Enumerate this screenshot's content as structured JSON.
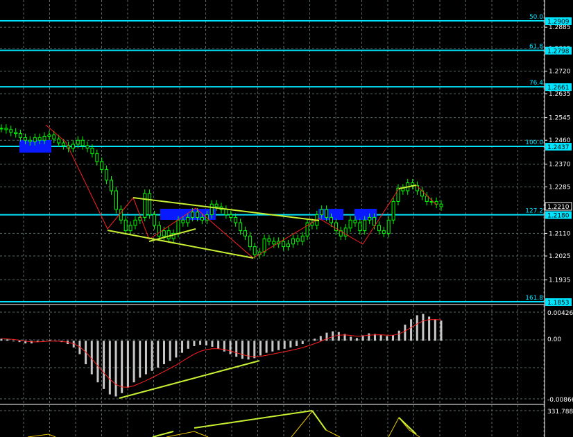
{
  "colors": {
    "background": "#000000",
    "grid": "#5a6a6a",
    "candle": "#00ff00",
    "fib_line": "#00e5ff",
    "zone": "#0a1aff",
    "trendline": "#c8f032",
    "macd_hist": "#c8c8c8",
    "signal": "#ff2020",
    "axis_text": "#ffffff"
  },
  "price_axis": {
    "ticks": [
      "1.2885",
      "1.2805",
      "1.2720",
      "1.2635",
      "1.2545",
      "1.2460",
      "1.2370",
      "1.2285",
      "1.2110",
      "1.2025",
      "1.1935"
    ],
    "current_price": "1.2210"
  },
  "fib_levels": [
    {
      "ratio": "50.0",
      "price": "1.2909"
    },
    {
      "ratio": "61.8",
      "price": "1.2798"
    },
    {
      "ratio": "76.4",
      "price": "1.2661"
    },
    {
      "ratio": "100.0",
      "price": "1.2437"
    },
    {
      "ratio": "127.2",
      "price": "1.2180"
    },
    {
      "ratio": "161.8",
      "price": "1.1853"
    }
  ],
  "macd_axis": {
    "top": "0.00426",
    "zero": "0.00",
    "bottom": "-0.00866"
  },
  "oscillator_axis": {
    "top": "331.7881"
  },
  "chart_data": {
    "type": "candlestick",
    "title": "",
    "series_close": [
      1.2505,
      1.25,
      1.249,
      1.2485,
      1.247,
      1.246,
      1.2455,
      1.247,
      1.246,
      1.2475,
      1.248,
      1.2465,
      1.245,
      1.244,
      1.243,
      1.2445,
      1.246,
      1.244,
      1.243,
      1.241,
      1.238,
      1.235,
      1.231,
      1.227,
      1.22,
      1.216,
      1.212,
      1.214,
      1.216,
      1.217,
      1.226,
      1.218,
      1.214,
      1.21,
      1.212,
      1.209,
      1.211,
      1.216,
      1.215,
      1.217,
      1.219,
      1.217,
      1.216,
      1.218,
      1.222,
      1.221,
      1.22,
      1.218,
      1.217,
      1.215,
      1.212,
      1.21,
      1.206,
      1.203,
      1.204,
      1.209,
      1.208,
      1.207,
      1.208,
      1.206,
      1.207,
      1.209,
      1.208,
      1.21,
      1.215,
      1.214,
      1.218,
      1.22,
      1.217,
      1.215,
      1.212,
      1.21,
      1.213,
      1.216,
      1.215,
      1.212,
      1.216,
      1.217,
      1.214,
      1.212,
      1.211,
      1.216,
      1.223,
      1.228,
      1.227,
      1.23,
      1.229,
      1.227,
      1.225,
      1.223,
      1.223,
      1.222,
      1.221
    ],
    "macd_hist": [
      0.0003,
      0.0002,
      0.0,
      -0.0002,
      -0.0004,
      -0.0004,
      -0.0002,
      0.0,
      0.0001,
      0.0,
      -0.0002,
      -0.0005,
      -0.001,
      -0.002,
      -0.0035,
      -0.005,
      -0.0062,
      -0.0072,
      -0.008,
      -0.0083,
      -0.0078,
      -0.007,
      -0.0062,
      -0.0055,
      -0.005,
      -0.0045,
      -0.004,
      -0.0035,
      -0.003,
      -0.0025,
      -0.0018,
      -0.0012,
      -0.0008,
      -0.0006,
      -0.0007,
      -0.0009,
      -0.0012,
      -0.0016,
      -0.002,
      -0.0024,
      -0.0027,
      -0.0028,
      -0.0026,
      -0.0022,
      -0.0018,
      -0.0016,
      -0.0014,
      -0.0012,
      -0.001,
      -0.0008,
      -0.0005,
      -0.0001,
      0.0003,
      0.0007,
      0.0012,
      0.0014,
      0.0013,
      0.001,
      0.0006,
      0.0004,
      0.0008,
      0.0011,
      0.001,
      0.0009,
      0.0007,
      0.0008,
      0.0015,
      0.0024,
      0.0032,
      0.0038,
      0.004,
      0.0036,
      0.0032,
      0.003
    ],
    "macd_axis_range": [
      -0.00866,
      0.00426
    ]
  }
}
